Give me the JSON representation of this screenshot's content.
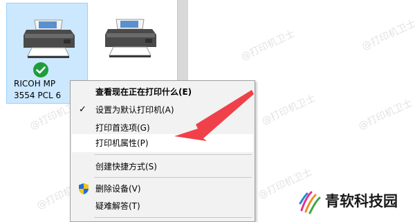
{
  "devices": [
    {
      "name_line1": "RICOH MP",
      "name_line2": "3554 PCL 6",
      "selected": true,
      "default": true
    },
    {
      "name_line1": "",
      "name_line2": "",
      "selected": false,
      "default": false
    }
  ],
  "context_menu": {
    "items": [
      {
        "label": "查看现在正在打印什么(E)",
        "bold": true
      },
      {
        "label": "设置为默认打印机(A)",
        "checked": true
      },
      {
        "label": "打印首选项(G)"
      },
      {
        "label": "打印机属性(P)",
        "highlighted": true
      },
      {
        "label": "创建快捷方式(S)"
      },
      {
        "label": "删除设备(V)",
        "icon": "uac-shield-icon"
      },
      {
        "label": "疑难解答(T)"
      }
    ],
    "check_glyph": "✓"
  },
  "watermark": {
    "text": "@打印机卫士"
  },
  "brand": {
    "text": "青软科技园"
  },
  "colors": {
    "selection_bg": "#cce8ff",
    "selection_border": "#99d1ff",
    "menu_bg": "#f2f2f2",
    "arrow": "#f0404a",
    "check_green": "#1f9d3c"
  }
}
